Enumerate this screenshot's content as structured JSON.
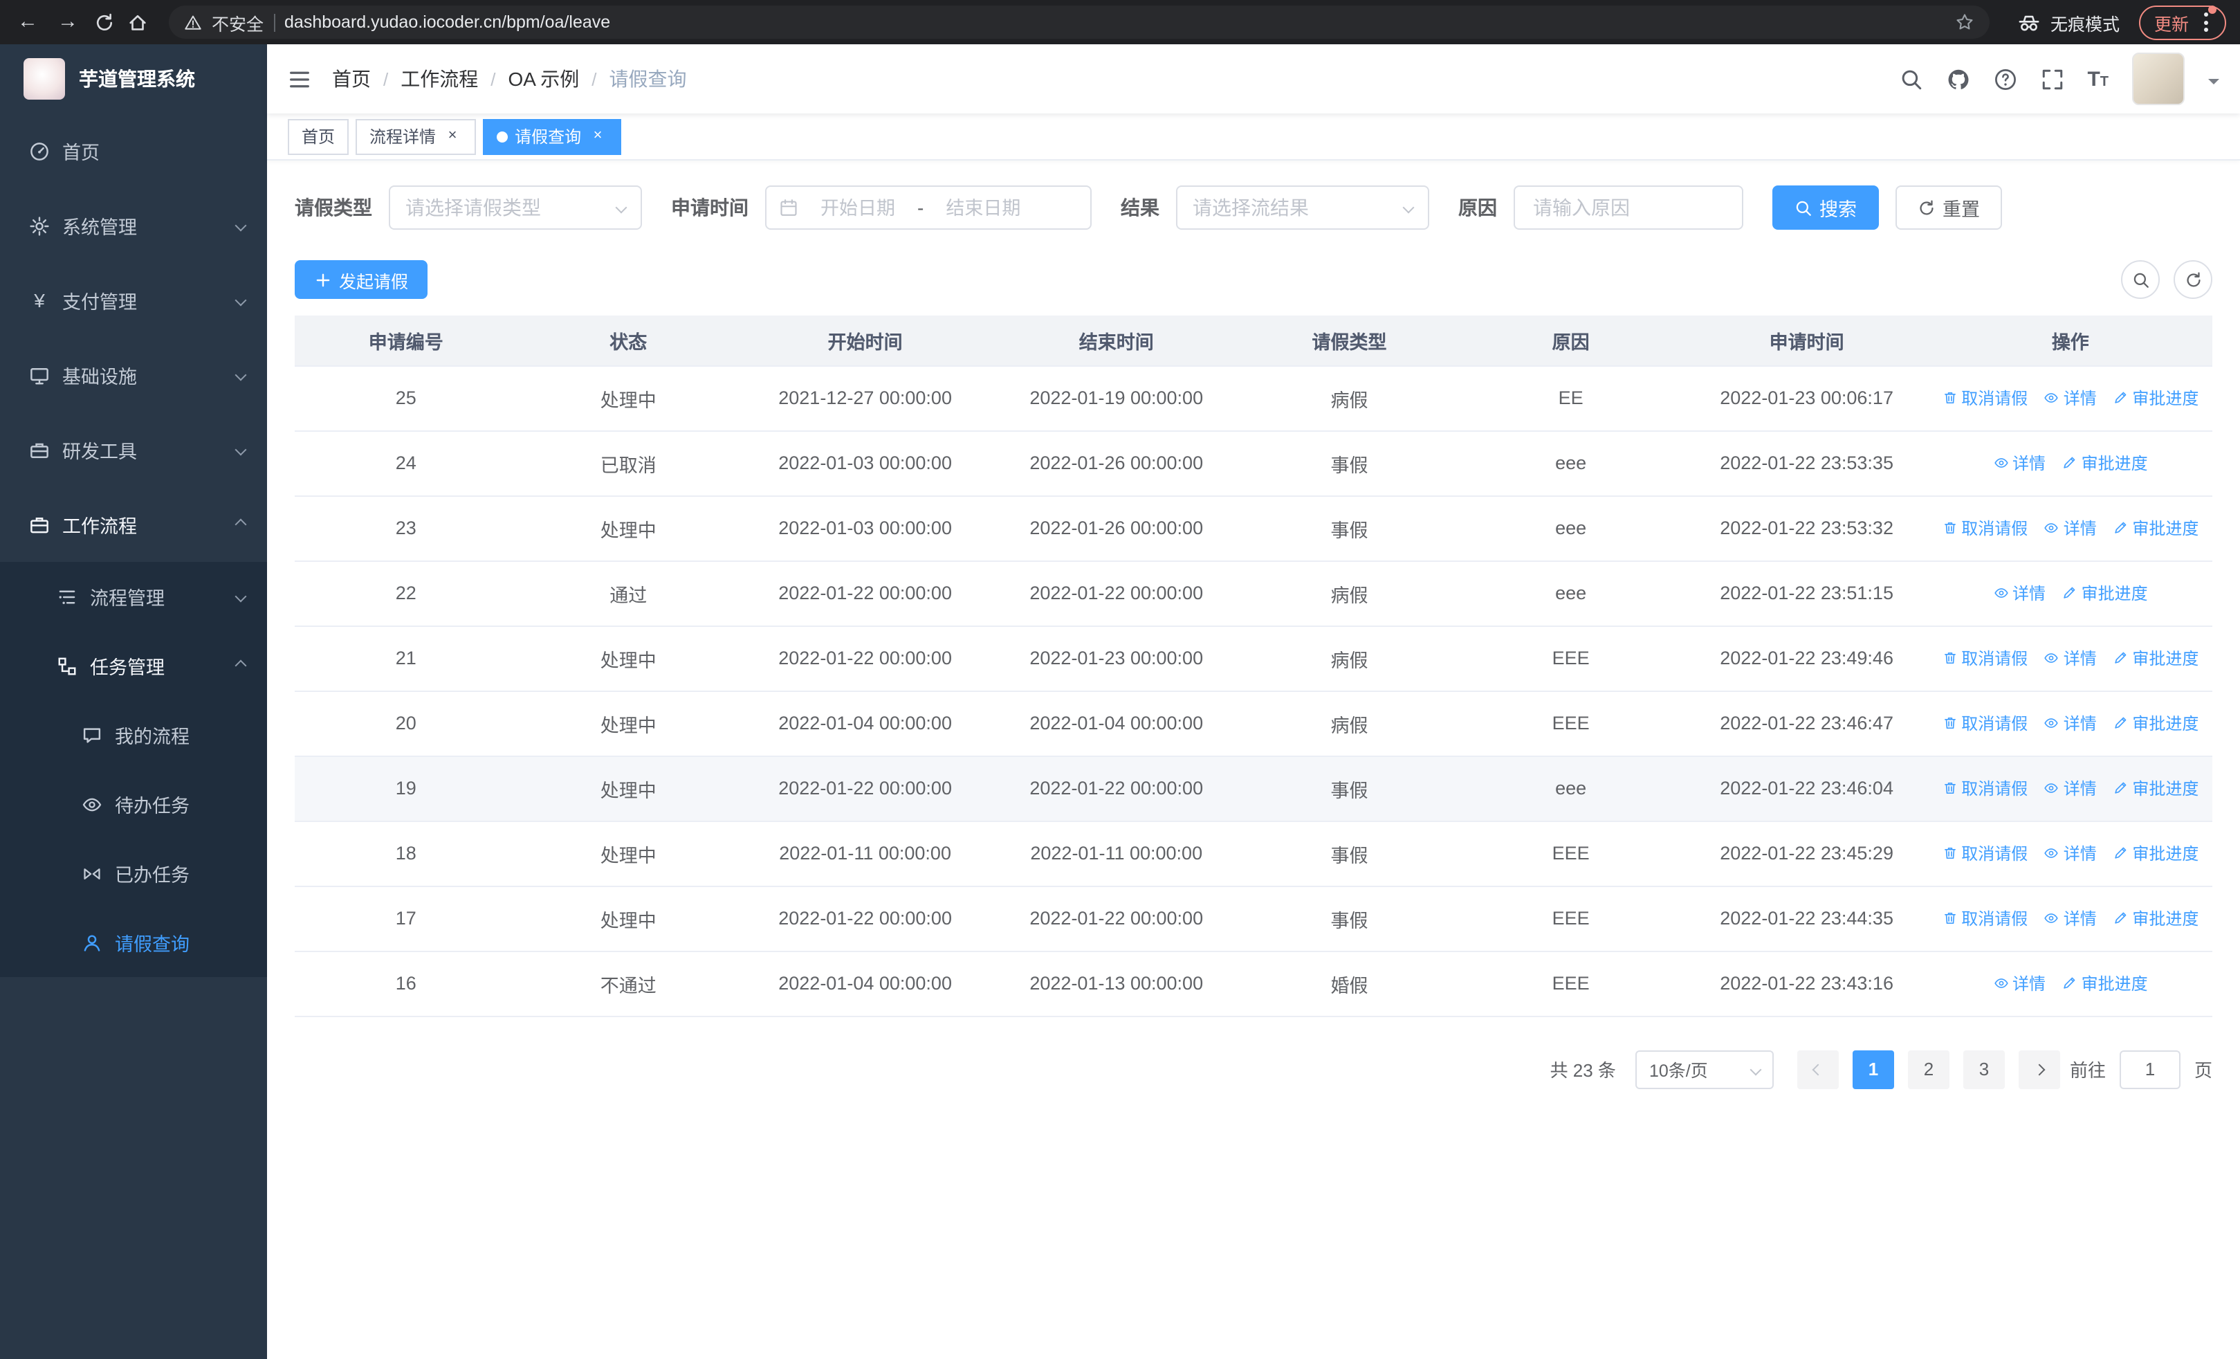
{
  "browser": {
    "security_warning": "不安全",
    "url": "dashboard.yudao.iocoder.cn/bpm/oa/leave",
    "incognito_label": "无痕模式",
    "update_label": "更新"
  },
  "sidebar": {
    "app_title": "芋道管理系统",
    "menu": {
      "home": "首页",
      "system": "系统管理",
      "payment": "支付管理",
      "infra": "基础设施",
      "devtools": "研发工具",
      "workflow": "工作流程",
      "process_mgmt": "流程管理",
      "task_mgmt": "任务管理",
      "my_process": "我的流程",
      "todo_tasks": "待办任务",
      "done_tasks": "已办任务",
      "leave_query": "请假查询"
    }
  },
  "header": {
    "separator": "/",
    "breadcrumb": [
      "首页",
      "工作流程",
      "OA 示例",
      "请假查询"
    ]
  },
  "tabs": {
    "close_glyph": "×",
    "items": [
      {
        "label": "首页",
        "closable": false,
        "active": false
      },
      {
        "label": "流程详情",
        "closable": true,
        "active": false
      },
      {
        "label": "请假查询",
        "closable": true,
        "active": true
      }
    ]
  },
  "filters": {
    "leave_type": {
      "label": "请假类型",
      "placeholder": "请选择请假类型"
    },
    "apply_time": {
      "label": "申请时间",
      "start_placeholder": "开始日期",
      "separator": "-",
      "end_placeholder": "结束日期"
    },
    "result": {
      "label": "结果",
      "placeholder": "请选择流结果"
    },
    "reason": {
      "label": "原因",
      "placeholder": "请输入原因"
    },
    "search_label": "搜索",
    "reset_label": "重置"
  },
  "toolbar": {
    "create_label": "发起请假"
  },
  "table": {
    "columns": [
      "申请编号",
      "状态",
      "开始时间",
      "结束时间",
      "请假类型",
      "原因",
      "申请时间",
      "操作"
    ],
    "action_labels": {
      "cancel": "取消请假",
      "detail": "详情",
      "progress": "审批进度"
    },
    "rows": [
      {
        "id": "25",
        "status": "处理中",
        "start": "2021-12-27 00:00:00",
        "end": "2022-01-19 00:00:00",
        "type": "病假",
        "reason": "EE",
        "applied": "2022-01-23 00:06:17",
        "can_cancel": true
      },
      {
        "id": "24",
        "status": "已取消",
        "start": "2022-01-03 00:00:00",
        "end": "2022-01-26 00:00:00",
        "type": "事假",
        "reason": "eee",
        "applied": "2022-01-22 23:53:35",
        "can_cancel": false
      },
      {
        "id": "23",
        "status": "处理中",
        "start": "2022-01-03 00:00:00",
        "end": "2022-01-26 00:00:00",
        "type": "事假",
        "reason": "eee",
        "applied": "2022-01-22 23:53:32",
        "can_cancel": true
      },
      {
        "id": "22",
        "status": "通过",
        "start": "2022-01-22 00:00:00",
        "end": "2022-01-22 00:00:00",
        "type": "病假",
        "reason": "eee",
        "applied": "2022-01-22 23:51:15",
        "can_cancel": false
      },
      {
        "id": "21",
        "status": "处理中",
        "start": "2022-01-22 00:00:00",
        "end": "2022-01-23 00:00:00",
        "type": "病假",
        "reason": "EEE",
        "applied": "2022-01-22 23:49:46",
        "can_cancel": true
      },
      {
        "id": "20",
        "status": "处理中",
        "start": "2022-01-04 00:00:00",
        "end": "2022-01-04 00:00:00",
        "type": "病假",
        "reason": "EEE",
        "applied": "2022-01-22 23:46:47",
        "can_cancel": true
      },
      {
        "id": "19",
        "status": "处理中",
        "start": "2022-01-22 00:00:00",
        "end": "2022-01-22 00:00:00",
        "type": "事假",
        "reason": "eee",
        "applied": "2022-01-22 23:46:04",
        "can_cancel": true
      },
      {
        "id": "18",
        "status": "处理中",
        "start": "2022-01-11 00:00:00",
        "end": "2022-01-11 00:00:00",
        "type": "事假",
        "reason": "EEE",
        "applied": "2022-01-22 23:45:29",
        "can_cancel": true
      },
      {
        "id": "17",
        "status": "处理中",
        "start": "2022-01-22 00:00:00",
        "end": "2022-01-22 00:00:00",
        "type": "事假",
        "reason": "EEE",
        "applied": "2022-01-22 23:44:35",
        "can_cancel": true
      },
      {
        "id": "16",
        "status": "不通过",
        "start": "2022-01-04 00:00:00",
        "end": "2022-01-13 00:00:00",
        "type": "婚假",
        "reason": "EEE",
        "applied": "2022-01-22 23:43:16",
        "can_cancel": false
      }
    ]
  },
  "pagination": {
    "total_text": "共 23 条",
    "page_size": "10条/页",
    "pages": [
      "1",
      "2",
      "3"
    ],
    "active_page": "1",
    "goto_label": "前往",
    "goto_value": "1",
    "unit_label": "页"
  },
  "colors": {
    "accent": "#409EFF",
    "sidebar_bg": "#293747",
    "submenu_bg": "#1f2d3d",
    "tag_active": "#409EFF"
  },
  "icons": {
    "back": "left-arrow",
    "forward": "right-arrow",
    "reload": "circular-arrow",
    "home": "house",
    "security": "warning-triangle",
    "bookmark": "star-outline",
    "incognito": "hat-and-glasses",
    "menu": "kebab-dots",
    "collapse-sidebar": "hamburger-lines",
    "search": "magnifier",
    "github": "octocat",
    "help": "question-circle",
    "fullscreen": "corner-brackets",
    "font-size": "Tt",
    "calendar": "calendar-grid",
    "select-caret": "chevron-down",
    "add": "plus",
    "cancel-action": "trash",
    "detail-action": "eye",
    "progress-action": "pen",
    "refresh": "circular-arrow"
  }
}
